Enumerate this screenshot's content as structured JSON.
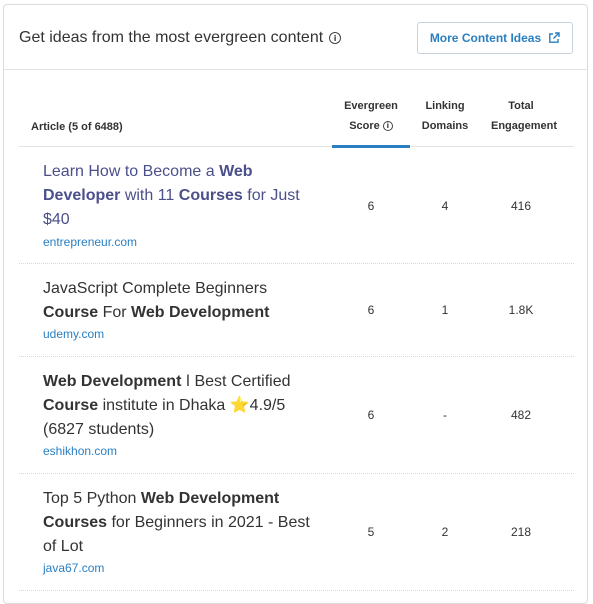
{
  "header": {
    "title": "Get ideas from the most evergreen content",
    "more_button": "More Content Ideas"
  },
  "table": {
    "columns": {
      "article": "Article (5 of 6488)",
      "evergreen_line1": "Evergreen",
      "evergreen_line2": "Score",
      "linking_line1": "Linking",
      "linking_line2": "Domains",
      "engagement_line1": "Total",
      "engagement_line2": "Engagement"
    },
    "rows": [
      {
        "title_parts": [
          "Learn How to Become a ",
          "Web Developer",
          " with 11 ",
          "Courses",
          " for Just $40"
        ],
        "domain": "entrepreneur.com",
        "evergreen": "6",
        "linking": "4",
        "engagement": "416"
      },
      {
        "title_parts": [
          "JavaScript Complete Beginners ",
          "Course",
          " For ",
          "Web Development"
        ],
        "domain": "udemy.com",
        "evergreen": "6",
        "linking": "1",
        "engagement": "1.8K"
      },
      {
        "title_parts": [
          "Web Development",
          " ǀ Best Certified ",
          "Course",
          " institute in Dhaka ",
          "⭐",
          "4.9/5 (6827 students)"
        ],
        "domain": "eshikhon.com",
        "evergreen": "6",
        "linking": "-",
        "engagement": "482"
      },
      {
        "title_parts": [
          "Top 5 Python ",
          "Web Development",
          " ",
          "Courses",
          " for Beginners in 2021 - Best of Lot"
        ],
        "domain": "java67.com",
        "evergreen": "5",
        "linking": "2",
        "engagement": "218"
      }
    ]
  },
  "colors": {
    "accent": "#2a7fc1",
    "visited_link": "#4b4f8a",
    "star": "#f5c518"
  },
  "icons": {
    "info": "info-icon",
    "external_link": "external-link-icon",
    "star": "star-icon"
  }
}
